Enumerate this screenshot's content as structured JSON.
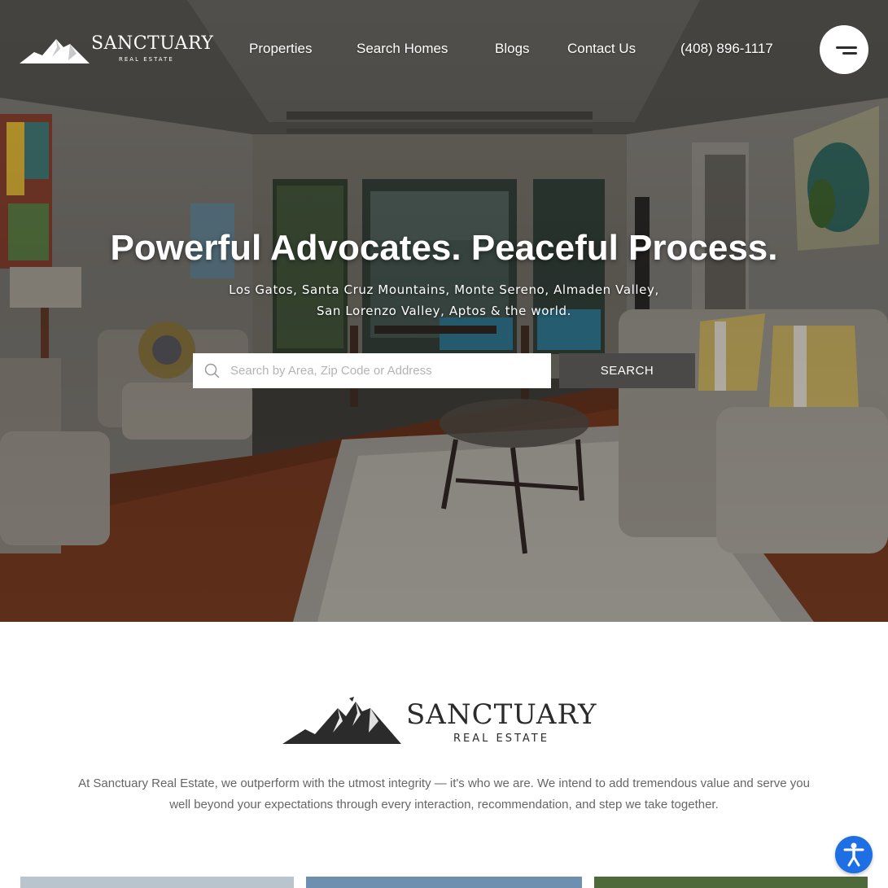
{
  "brand": {
    "name": "SANCTUARY",
    "tagline": "REAL ESTATE"
  },
  "nav": {
    "items": [
      "Properties",
      "Search Homes",
      "Blogs",
      "Contact Us"
    ],
    "phone": "(408) 896-1117"
  },
  "hero": {
    "title": "Powerful Advocates. Peaceful Process.",
    "subtitle_line1": "Los Gatos, Santa Cruz Mountains, Monte Sereno, Almaden Valley,",
    "subtitle_line2": "San Lorenzo Valley, Aptos & the world."
  },
  "search": {
    "placeholder": "Search by Area, Zip Code or Address",
    "button_label": "SEARCH"
  },
  "intro": {
    "brand_name": "SANCTUARY",
    "brand_tagline": "REAL ESTATE",
    "text": "At Sanctuary Real Estate, we outperform with the utmost integrity — it's who we are. We intend to add tremendous value and serve you well beyond your expectations through every interaction, recommendation, and step we take together."
  },
  "icons": {
    "menu": "hamburger-menu-icon",
    "search": "search-icon",
    "accessibility": "accessibility-icon",
    "logo": "mountain-logo-icon"
  },
  "colors": {
    "search_button": "#4b4848",
    "accessibility_button": "#1d6fe3",
    "text_muted": "#666666",
    "brand_dark": "#2b2b2b"
  }
}
